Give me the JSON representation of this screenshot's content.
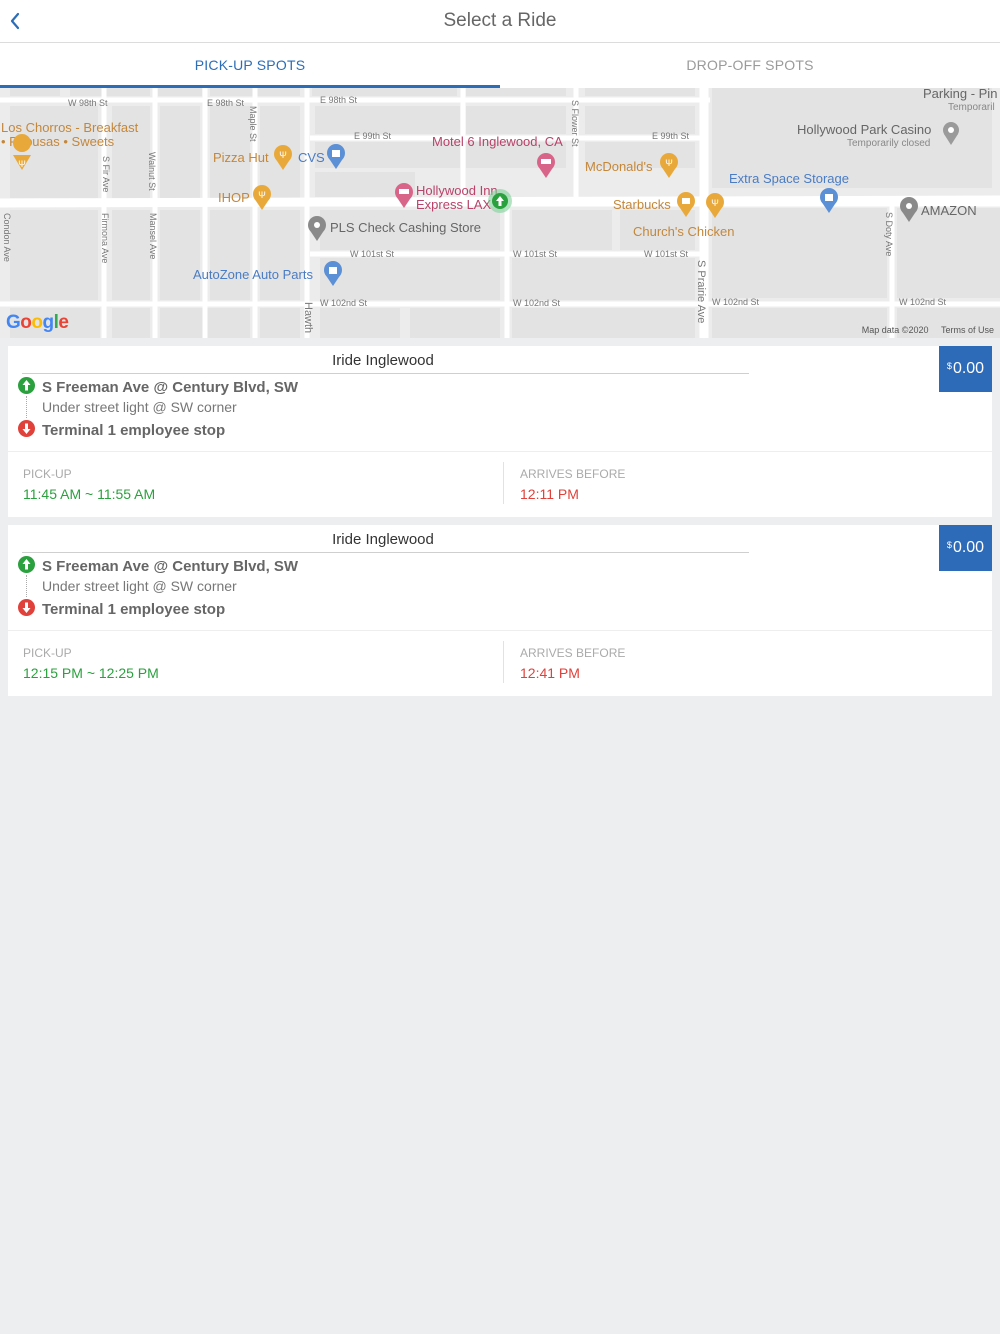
{
  "header": {
    "title": "Select a Ride"
  },
  "tabs": [
    {
      "label": "PICK-UP SPOTS",
      "active": true
    },
    {
      "label": "DROP-OFF SPOTS",
      "active": false
    }
  ],
  "map": {
    "streets": {
      "w98": "W 98th St",
      "e98a": "E 98th St",
      "e98b": "E 98th St",
      "e99a": "E 99th St",
      "e99b": "E 99th St",
      "w101a": "W 101st St",
      "w101b": "W 101st St",
      "w101c": "W 101st St",
      "w102a": "W 102nd St",
      "w102b": "W 102nd St",
      "w102c": "W 102nd St",
      "w102d": "W 102nd St",
      "condon": "Condon Ave",
      "sfir": "S Fir Ave",
      "firmona": "Firmona Ave",
      "walnut": "Walnut St",
      "mansel": "Mansel Ave",
      "maple": "Maple St",
      "sflower": "S Flower St",
      "sprairie": "S Prairie Ave",
      "sdoty": "S Doty Ave",
      "hawth": "Hawth"
    },
    "pois": {
      "los_chorros_1": "Los Chorros - Breakfast",
      "los_chorros_2": "• Pupusas • Sweets",
      "pizza_hut": "Pizza Hut",
      "cvs": "CVS",
      "ihop": "IHOP",
      "motel6": "Motel 6 Inglewood, CA",
      "hollywood_inn_1": "Hollywood Inn",
      "hollywood_inn_2": "Express LAX",
      "mcdonalds": "McDonald's",
      "pls": "PLS Check Cashing Store",
      "autozone": "AutoZone Auto Parts",
      "starbucks": "Starbucks",
      "churchs": "Church's Chicken",
      "extra_space": "Extra Space Storage",
      "hollywood_park": "Hollywood Park Casino",
      "temp_closed": "Temporarily closed",
      "parking_1": "Parking - Pin",
      "parking_2": "Temporaril",
      "amazon": "AMAZON"
    },
    "logo": "Google",
    "map_data": "Map data ©2020",
    "terms": "Terms of Use"
  },
  "rides": [
    {
      "operator": "Iride Inglewood",
      "currency": "$",
      "price": "0.00",
      "pickup_stop": "S Freeman Ave @ Century Blvd, SW",
      "pickup_desc": "Under street light @ SW corner",
      "dropoff_stop": "Terminal 1 employee stop",
      "pickup_label": "PICK-UP",
      "pickup_time": "11:45 AM ~ 11:55 AM",
      "arrives_label": "ARRIVES BEFORE",
      "arrives_time": "12:11 PM"
    },
    {
      "operator": "Iride Inglewood",
      "currency": "$",
      "price": "0.00",
      "pickup_stop": "S Freeman Ave @ Century Blvd, SW",
      "pickup_desc": "Under street light @ SW corner",
      "dropoff_stop": "Terminal 1 employee stop",
      "pickup_label": "PICK-UP",
      "pickup_time": "12:15 PM ~ 12:25 PM",
      "arrives_label": "ARRIVES BEFORE",
      "arrives_time": "12:41 PM"
    }
  ],
  "colors": {
    "accent": "#2c6db8",
    "price_bg": "#2d6ab8",
    "pickup_green": "#2ba03e",
    "arrive_red": "#e0413a",
    "page_bg": "#eceef0"
  }
}
